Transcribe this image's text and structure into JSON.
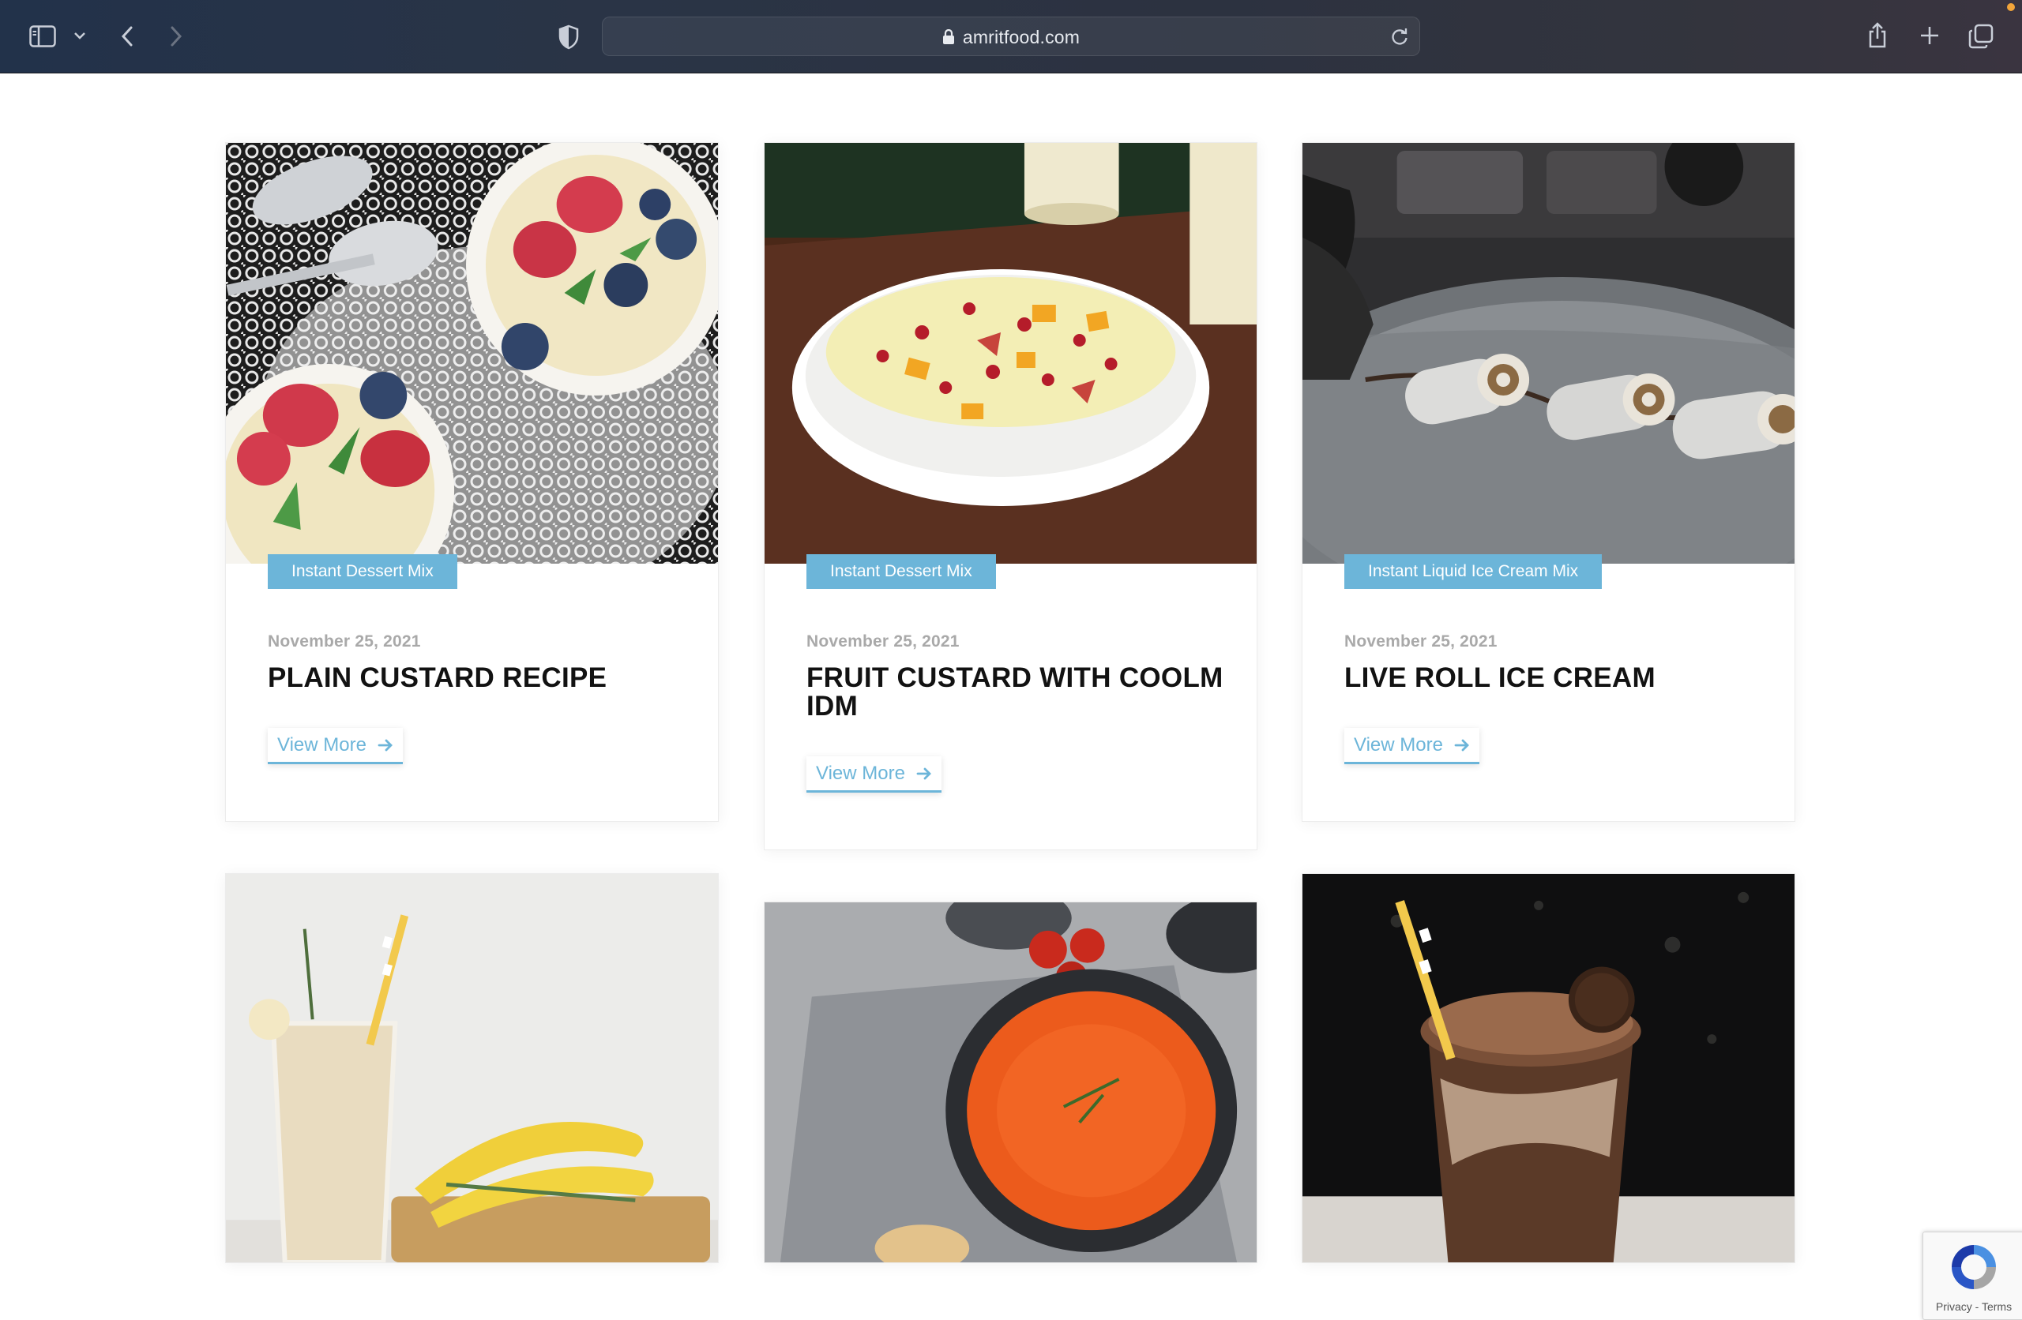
{
  "browser": {
    "url": "amritfood.com",
    "icons": [
      "sidebar-icon",
      "chevron-down-icon",
      "back-icon",
      "forward-icon",
      "shield-icon",
      "lock-icon",
      "reload-icon",
      "share-icon",
      "new-tab-icon",
      "tabs-overview-icon"
    ]
  },
  "cards": [
    {
      "category": "Instant Dessert Mix",
      "date": "November 25, 2021",
      "title": "PLAIN CUSTARD RECIPE",
      "cta": "View More"
    },
    {
      "category": "Instant Dessert Mix",
      "date": "November 25, 2021",
      "title": "FRUIT CUSTARD WITH COOLM IDM",
      "cta": "View More"
    },
    {
      "category": "Instant Liquid Ice Cream Mix",
      "date": "November 25, 2021",
      "title": "LIVE ROLL ICE CREAM",
      "cta": "View More"
    }
  ],
  "recaptcha": {
    "links": "Privacy - Terms"
  },
  "colors": {
    "accent": "#6cb5d9",
    "title": "#121212",
    "date": "#a9a9a9"
  }
}
